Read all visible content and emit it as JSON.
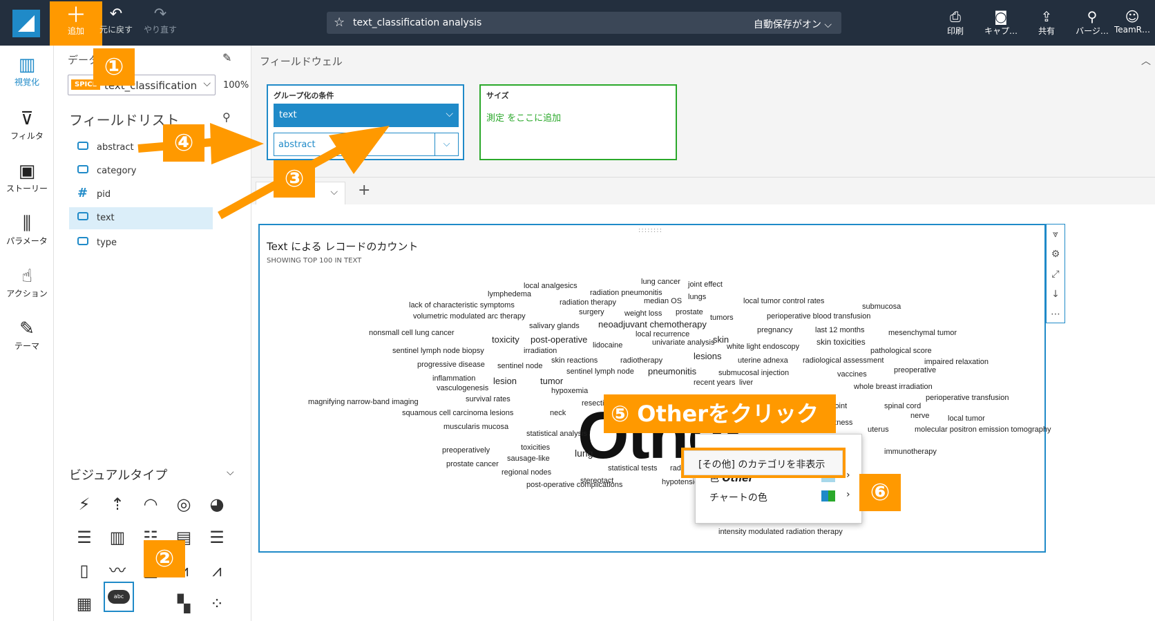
{
  "toolbar": {
    "add": "追加",
    "undo": "元に戻す",
    "redo": "やり直す",
    "analysis_title": "text_classification analysis",
    "autosave": "自動保存がオン",
    "print": "印刷",
    "capture": "キャプ…",
    "share": "共有",
    "version": "バージ…",
    "user": "TeamR…"
  },
  "rail": {
    "visualize": "視覚化",
    "filter": "フィルタ",
    "story": "ストーリー",
    "parameter": "パラメータ",
    "action": "アクション",
    "theme": "テーマ"
  },
  "data_panel": {
    "label": "データ",
    "spice": "SPICE",
    "dataset": "text_classification",
    "percent": "100%",
    "field_list_title": "フィールドリスト",
    "fields": [
      "abstract",
      "category",
      "pid",
      "text",
      "type"
    ],
    "visual_types_title": "ビジュアルタイプ",
    "selected_visual_icon": "abc"
  },
  "field_wells": {
    "title": "フィールドウェル",
    "group_label": "グループ化の条件",
    "group_field_1": "text",
    "group_field_2": "abstract",
    "size_label": "サイズ",
    "size_placeholder": "測定 をここに追加"
  },
  "visual": {
    "title": "Text による レコードのカウント",
    "subtitle": "SHOWING TOP 100 IN TEXT",
    "big_word": "Other"
  },
  "context_menu": {
    "hide_other": "[その他] のカテゴリを非表示",
    "color_other_prefix": "色",
    "color_other_word": "Other",
    "chart_colors": "チャートの色",
    "below_word": "intensity modulated radiation therapy"
  },
  "annotations": {
    "b1": "①",
    "b2": "②",
    "b3": "③",
    "b4": "④",
    "b5": "⑤ Otherをクリック",
    "b6": "⑥"
  },
  "colors": {
    "accent": "#1f8ac8",
    "annotation": "#ff9900",
    "well_size": "#2aa82a",
    "topbar": "#232f3e"
  },
  "words": [
    {
      "t": "local analgesics",
      "s": 11
    },
    {
      "t": "lung cancer",
      "s": 11
    },
    {
      "t": "joint effect",
      "s": 11
    },
    {
      "t": "lymphedema",
      "s": 11
    },
    {
      "t": "radiation pneumonitis",
      "s": 11
    },
    {
      "t": "lungs",
      "s": 11
    },
    {
      "t": "radiation therapy",
      "s": 11
    },
    {
      "t": "median OS",
      "s": 11
    },
    {
      "t": "local tumor control rates",
      "s": 11
    },
    {
      "t": "submucosa",
      "s": 11
    },
    {
      "t": "lack of characteristic symptoms",
      "s": 11
    },
    {
      "t": "surgery",
      "s": 11
    },
    {
      "t": "weight loss",
      "s": 11
    },
    {
      "t": "prostate",
      "s": 11
    },
    {
      "t": "tumors",
      "s": 11
    },
    {
      "t": "perioperative blood transfusion",
      "s": 11
    },
    {
      "t": "volumetric modulated arc therapy",
      "s": 11
    },
    {
      "t": "salivary glands",
      "s": 11
    },
    {
      "t": "neoadjuvant chemotherapy",
      "s": 13
    },
    {
      "t": "pregnancy",
      "s": 11
    },
    {
      "t": "last 12 months",
      "s": 11
    },
    {
      "t": "mesenchymal tumor",
      "s": 11
    },
    {
      "t": "nonsmall cell lung cancer",
      "s": 11
    },
    {
      "t": "local recurrence",
      "s": 11
    },
    {
      "t": "toxicity",
      "s": 13
    },
    {
      "t": "post-operative",
      "s": 13
    },
    {
      "t": "univariate analysis",
      "s": 11
    },
    {
      "t": "skin",
      "s": 13
    },
    {
      "t": "skin toxicities",
      "s": 12
    },
    {
      "t": "lidocaine",
      "s": 11
    },
    {
      "t": "white light endoscopy",
      "s": 11
    },
    {
      "t": "sentinel lymph node biopsy",
      "s": 11
    },
    {
      "t": "irradiation",
      "s": 11
    },
    {
      "t": "pathological score",
      "s": 11
    },
    {
      "t": "lesions",
      "s": 13
    },
    {
      "t": "skin reactions",
      "s": 11
    },
    {
      "t": "radiotherapy",
      "s": 11
    },
    {
      "t": "uterine adnexa",
      "s": 11
    },
    {
      "t": "radiological assessment",
      "s": 11
    },
    {
      "t": "impaired relaxation",
      "s": 11
    },
    {
      "t": "progressive disease",
      "s": 11
    },
    {
      "t": "sentinel node",
      "s": 11
    },
    {
      "t": "pneumonitis",
      "s": 13
    },
    {
      "t": "preoperative",
      "s": 11
    },
    {
      "t": "sentinel lymph node",
      "s": 11
    },
    {
      "t": "submucosal injection",
      "s": 11
    },
    {
      "t": "vaccines",
      "s": 11
    },
    {
      "t": "inflammation",
      "s": 11
    },
    {
      "t": "lesion",
      "s": 13
    },
    {
      "t": "tumor",
      "s": 13
    },
    {
      "t": "recent years",
      "s": 11
    },
    {
      "t": "liver",
      "s": 11
    },
    {
      "t": "vasculogenesis",
      "s": 11
    },
    {
      "t": "hypoxemia",
      "s": 11
    },
    {
      "t": "whole breast irradiation",
      "s": 11
    },
    {
      "t": "survival rates",
      "s": 11
    },
    {
      "t": "perioperative transfusion",
      "s": 11
    },
    {
      "t": "magnifying narrow-band imaging",
      "s": 11
    },
    {
      "t": "resection",
      "s": 11
    },
    {
      "t": "joint",
      "s": 11
    },
    {
      "t": "spinal cord",
      "s": 11
    },
    {
      "t": "squamous cell carcinoma lesions",
      "s": 11
    },
    {
      "t": "neck",
      "s": 11
    },
    {
      "t": "nerve",
      "s": 11
    },
    {
      "t": "local tumor",
      "s": 11
    },
    {
      "t": "muscularis mucosa",
      "s": 11
    },
    {
      "t": "overweightness",
      "s": 11
    },
    {
      "t": "uterus",
      "s": 11
    },
    {
      "t": "molecular positron emission tomography",
      "s": 11
    },
    {
      "t": "statistical analysis",
      "s": 11
    },
    {
      "t": "toxicities",
      "s": 11
    },
    {
      "t": "immunotherapy",
      "s": 11
    },
    {
      "t": "preoperatively",
      "s": 11
    },
    {
      "t": "lung",
      "s": 14
    },
    {
      "t": "sausage-like",
      "s": 11
    },
    {
      "t": "prostate cancer",
      "s": 11
    },
    {
      "t": "statistical tests",
      "s": 11
    },
    {
      "t": "radiation toxicities",
      "s": 11
    },
    {
      "t": "regional nodes",
      "s": 11
    },
    {
      "t": "stereotact",
      "s": 11
    },
    {
      "t": "hypotension",
      "s": 11
    },
    {
      "t": "post-operative complications",
      "s": 11
    }
  ]
}
